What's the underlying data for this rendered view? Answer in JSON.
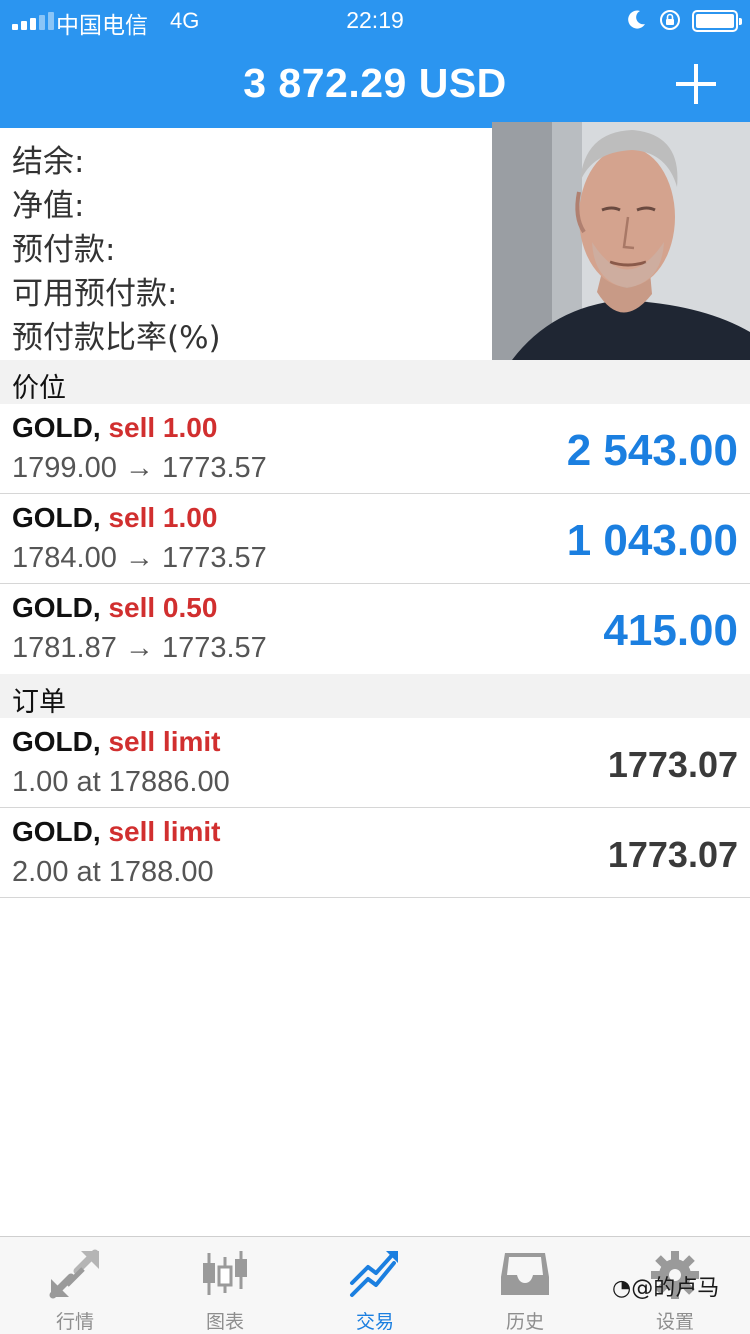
{
  "status_bar": {
    "carrier": "中国电信",
    "network": "4G",
    "time": "22:19"
  },
  "header": {
    "balance": "3 872.29 USD",
    "add_icon": "plus-icon"
  },
  "summary": {
    "labels": [
      "结余:",
      "净值:",
      "预付款:",
      "可用预付款:",
      "预付款比率(%)"
    ]
  },
  "positions": {
    "title": "价位",
    "items": [
      {
        "symbol": "GOLD,",
        "side": "sell 1.00",
        "prices": "1799.00 → 1773.57",
        "profit": "2 543.00"
      },
      {
        "symbol": "GOLD,",
        "side": "sell 1.00",
        "prices": "1784.00 → 1773.57",
        "profit": "1 043.00"
      },
      {
        "symbol": "GOLD,",
        "side": "sell 0.50",
        "prices": "1781.87 → 1773.57",
        "profit": "415.00"
      }
    ]
  },
  "orders": {
    "title": "订单",
    "items": [
      {
        "symbol": "GOLD,",
        "side": "sell limit",
        "detail": "1.00 at 17886.00",
        "price": "1773.07"
      },
      {
        "symbol": "GOLD,",
        "side": "sell limit",
        "detail": "2.00 at 1788.00",
        "price": "1773.07"
      }
    ]
  },
  "tabs": [
    {
      "label": "行情",
      "icon": "quotes-arrows-icon"
    },
    {
      "label": "图表",
      "icon": "candlestick-chart-icon"
    },
    {
      "label": "交易",
      "icon": "trade-chart-icon",
      "active": true
    },
    {
      "label": "历史",
      "icon": "history-inbox-icon"
    },
    {
      "label": "设置",
      "icon": "settings-gear-icon"
    }
  ],
  "watermark": "@的卢马",
  "colors": {
    "header_blue": "#2b95f0",
    "profit_blue": "#1b7fe0",
    "sell_red": "#d12f2f",
    "section_gray": "#f2f2f2"
  }
}
